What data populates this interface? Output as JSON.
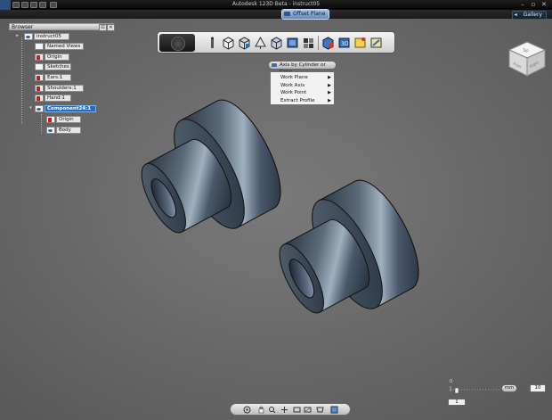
{
  "window": {
    "title": "Autodesk 123D Beta - instruct05",
    "minimize": "–",
    "maximize": "▫",
    "close": "✕"
  },
  "ribbon": {
    "gallery_label": "Gallery",
    "offset_plane_label": "Offset Plane"
  },
  "browser": {
    "header": "Browser",
    "pin": "⊡",
    "close": "✕",
    "items": [
      {
        "label": "instruct05",
        "icon": "part-icon"
      },
      {
        "label": "Named Views",
        "icon": "folder-icon"
      },
      {
        "label": "Origin",
        "icon": "hidden-icon"
      },
      {
        "label": "Sketches",
        "icon": "folder-icon"
      },
      {
        "label": "Ears:1",
        "icon": "hidden-icon"
      },
      {
        "label": "Shoulders:1",
        "icon": "hidden-icon"
      },
      {
        "label": "Hand:1",
        "icon": "hidden-icon"
      },
      {
        "label": "Component24:1",
        "icon": "visible-icon",
        "selected": true
      },
      {
        "label": "Origin",
        "icon": "hidden-icon"
      },
      {
        "label": "Body",
        "icon": "visible-icon"
      }
    ]
  },
  "toolbar": {
    "tools": [
      "home-view-icon",
      "sketch-icon",
      "primitive-box-icon",
      "construct-icon",
      "modify-icon",
      "pattern-icon",
      "group-icon",
      "grouping-icon",
      "materials-icon",
      "measure-icon",
      "snap-icon",
      "assemble-icon"
    ]
  },
  "flyout": {
    "label": "Axis by Cylinder or Cone"
  },
  "context_menu": {
    "items": [
      "Work Plane",
      "Work Axis",
      "Work Point",
      "Extract Profile"
    ],
    "submenu_arrow": "▶"
  },
  "viewcube": {
    "top": "Top",
    "front": "Front",
    "right": "Right"
  },
  "ruler": {
    "unit": "mm",
    "scale_value": "10",
    "start": "0",
    "value": "1"
  },
  "navbar": {
    "tools": [
      "orbit-icon",
      "pan-icon",
      "zoom-icon",
      "look-at-icon",
      "fit-icon",
      "window-zoom-icon",
      "perspective-icon",
      "visual-style-icon"
    ]
  },
  "colors": {
    "viewport": "#6b6b6b",
    "selected": "#1d6fcc",
    "part_dark": "#1c2733",
    "part_mid": "#4c5b6a",
    "part_light": "#b9c6d2"
  }
}
